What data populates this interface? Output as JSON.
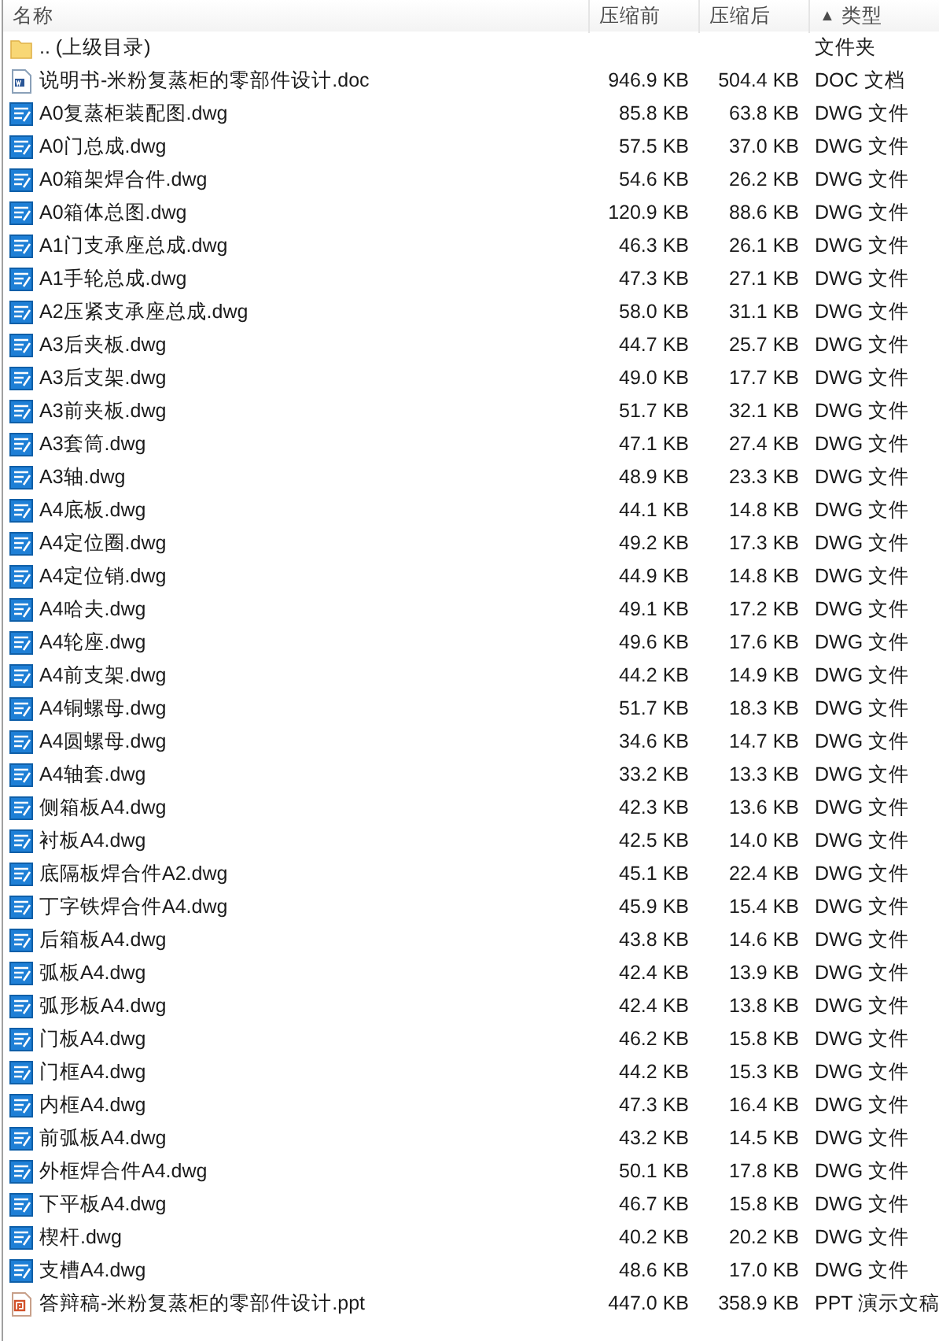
{
  "columns": [
    {
      "label": "名称"
    },
    {
      "label": "压缩前"
    },
    {
      "label": "压缩后"
    },
    {
      "label": "类型",
      "sort_indicator": "▲"
    }
  ],
  "rows": [
    {
      "kind": "folder",
      "name": ".. (上级目录)",
      "type": "文件夹"
    },
    {
      "kind": "doc",
      "name": "说明书-米粉复蒸柜的零部件设计.doc",
      "before": "946.9 KB",
      "after": "504.4 KB",
      "type": "DOC 文档"
    },
    {
      "kind": "dwg",
      "name": "A0复蒸柜装配图.dwg",
      "before": "85.8 KB",
      "after": "63.8 KB",
      "type": "DWG 文件"
    },
    {
      "kind": "dwg",
      "name": "A0门总成.dwg",
      "before": "57.5 KB",
      "after": "37.0 KB",
      "type": "DWG 文件"
    },
    {
      "kind": "dwg",
      "name": "A0箱架焊合件.dwg",
      "before": "54.6 KB",
      "after": "26.2 KB",
      "type": "DWG 文件"
    },
    {
      "kind": "dwg",
      "name": "A0箱体总图.dwg",
      "before": "120.9 KB",
      "after": "88.6 KB",
      "type": "DWG 文件"
    },
    {
      "kind": "dwg",
      "name": "A1门支承座总成.dwg",
      "before": "46.3 KB",
      "after": "26.1 KB",
      "type": "DWG 文件"
    },
    {
      "kind": "dwg",
      "name": "A1手轮总成.dwg",
      "before": "47.3 KB",
      "after": "27.1 KB",
      "type": "DWG 文件"
    },
    {
      "kind": "dwg",
      "name": "A2压紧支承座总成.dwg",
      "before": "58.0 KB",
      "after": "31.1 KB",
      "type": "DWG 文件"
    },
    {
      "kind": "dwg",
      "name": "A3后夹板.dwg",
      "before": "44.7 KB",
      "after": "25.7 KB",
      "type": "DWG 文件"
    },
    {
      "kind": "dwg",
      "name": "A3后支架.dwg",
      "before": "49.0 KB",
      "after": "17.7 KB",
      "type": "DWG 文件"
    },
    {
      "kind": "dwg",
      "name": "A3前夹板.dwg",
      "before": "51.7 KB",
      "after": "32.1 KB",
      "type": "DWG 文件"
    },
    {
      "kind": "dwg",
      "name": "A3套筒.dwg",
      "before": "47.1 KB",
      "after": "27.4 KB",
      "type": "DWG 文件"
    },
    {
      "kind": "dwg",
      "name": "A3轴.dwg",
      "before": "48.9 KB",
      "after": "23.3 KB",
      "type": "DWG 文件"
    },
    {
      "kind": "dwg",
      "name": "A4底板.dwg",
      "before": "44.1 KB",
      "after": "14.8 KB",
      "type": "DWG 文件"
    },
    {
      "kind": "dwg",
      "name": "A4定位圈.dwg",
      "before": "49.2 KB",
      "after": "17.3 KB",
      "type": "DWG 文件"
    },
    {
      "kind": "dwg",
      "name": "A4定位销.dwg",
      "before": "44.9 KB",
      "after": "14.8 KB",
      "type": "DWG 文件"
    },
    {
      "kind": "dwg",
      "name": "A4哈夫.dwg",
      "before": "49.1 KB",
      "after": "17.2 KB",
      "type": "DWG 文件"
    },
    {
      "kind": "dwg",
      "name": "A4轮座.dwg",
      "before": "49.6 KB",
      "after": "17.6 KB",
      "type": "DWG 文件"
    },
    {
      "kind": "dwg",
      "name": "A4前支架.dwg",
      "before": "44.2 KB",
      "after": "14.9 KB",
      "type": "DWG 文件"
    },
    {
      "kind": "dwg",
      "name": "A4铜螺母.dwg",
      "before": "51.7 KB",
      "after": "18.3 KB",
      "type": "DWG 文件"
    },
    {
      "kind": "dwg",
      "name": "A4圆螺母.dwg",
      "before": "34.6 KB",
      "after": "14.7 KB",
      "type": "DWG 文件"
    },
    {
      "kind": "dwg",
      "name": "A4轴套.dwg",
      "before": "33.2 KB",
      "after": "13.3 KB",
      "type": "DWG 文件"
    },
    {
      "kind": "dwg",
      "name": "侧箱板A4.dwg",
      "before": "42.3 KB",
      "after": "13.6 KB",
      "type": "DWG 文件"
    },
    {
      "kind": "dwg",
      "name": "衬板A4.dwg",
      "before": "42.5 KB",
      "after": "14.0 KB",
      "type": "DWG 文件"
    },
    {
      "kind": "dwg",
      "name": "底隔板焊合件A2.dwg",
      "before": "45.1 KB",
      "after": "22.4 KB",
      "type": "DWG 文件"
    },
    {
      "kind": "dwg",
      "name": "丁字铁焊合件A4.dwg",
      "before": "45.9 KB",
      "after": "15.4 KB",
      "type": "DWG 文件"
    },
    {
      "kind": "dwg",
      "name": "后箱板A4.dwg",
      "before": "43.8 KB",
      "after": "14.6 KB",
      "type": "DWG 文件"
    },
    {
      "kind": "dwg",
      "name": "弧板A4.dwg",
      "before": "42.4 KB",
      "after": "13.9 KB",
      "type": "DWG 文件"
    },
    {
      "kind": "dwg",
      "name": "弧形板A4.dwg",
      "before": "42.4 KB",
      "after": "13.8 KB",
      "type": "DWG 文件"
    },
    {
      "kind": "dwg",
      "name": "门板A4.dwg",
      "before": "46.2 KB",
      "after": "15.8 KB",
      "type": "DWG 文件"
    },
    {
      "kind": "dwg",
      "name": "门框A4.dwg",
      "before": "44.2 KB",
      "after": "15.3 KB",
      "type": "DWG 文件"
    },
    {
      "kind": "dwg",
      "name": "内框A4.dwg",
      "before": "47.3 KB",
      "after": "16.4 KB",
      "type": "DWG 文件"
    },
    {
      "kind": "dwg",
      "name": "前弧板A4.dwg",
      "before": "43.2 KB",
      "after": "14.5 KB",
      "type": "DWG 文件"
    },
    {
      "kind": "dwg",
      "name": "外框焊合件A4.dwg",
      "before": "50.1 KB",
      "after": "17.8 KB",
      "type": "DWG 文件"
    },
    {
      "kind": "dwg",
      "name": "下平板A4.dwg",
      "before": "46.7 KB",
      "after": "15.8 KB",
      "type": "DWG 文件"
    },
    {
      "kind": "dwg",
      "name": "楔杆.dwg",
      "before": "40.2 KB",
      "after": "20.2 KB",
      "type": "DWG 文件"
    },
    {
      "kind": "dwg",
      "name": "支槽A4.dwg",
      "before": "48.6 KB",
      "after": "17.0 KB",
      "type": "DWG 文件"
    },
    {
      "kind": "ppt",
      "name": "答辩稿-米粉复蒸柜的零部件设计.ppt",
      "before": "447.0 KB",
      "after": "358.9 KB",
      "type": "PPT 演示文稿"
    }
  ]
}
